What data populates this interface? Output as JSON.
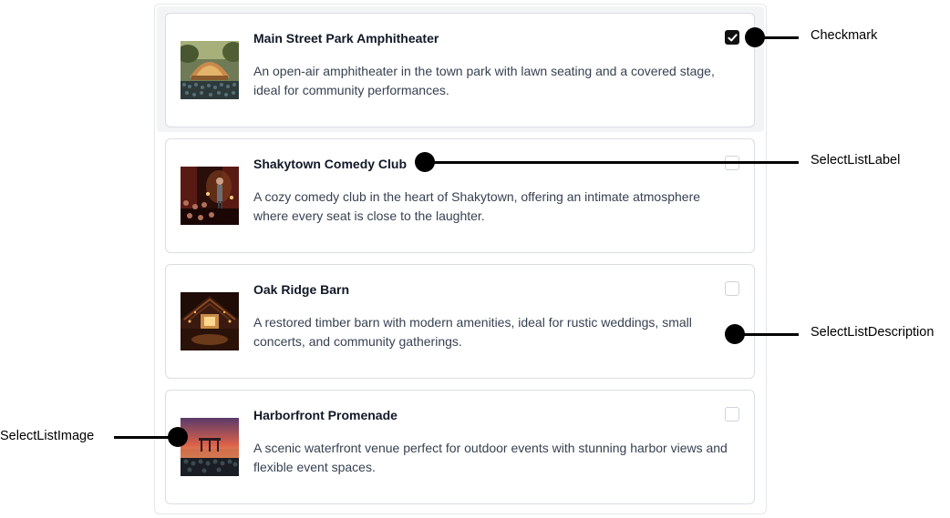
{
  "items": [
    {
      "label": "Main Street Park Amphitheater",
      "description": "An open-air amphitheater in the town park with lawn seating and a covered stage, ideal for community performances.",
      "selected": true
    },
    {
      "label": "Shakytown Comedy Club",
      "description": "A cozy comedy club in the heart of Shakytown, offering an intimate atmosphere where every seat is close to the laughter.",
      "selected": false
    },
    {
      "label": "Oak Ridge Barn",
      "description": "A restored timber barn with modern amenities, ideal for rustic weddings, small concerts, and community gatherings.",
      "selected": false
    },
    {
      "label": "Harborfront Promenade",
      "description": "A scenic waterfront venue perfect for outdoor events with stunning harbor views and flexible event spaces.",
      "selected": false
    }
  ],
  "annotations": {
    "checkmark": "Checkmark",
    "label": "SelectListLabel",
    "description": "SelectListDescription",
    "image": "SelectListImage"
  }
}
